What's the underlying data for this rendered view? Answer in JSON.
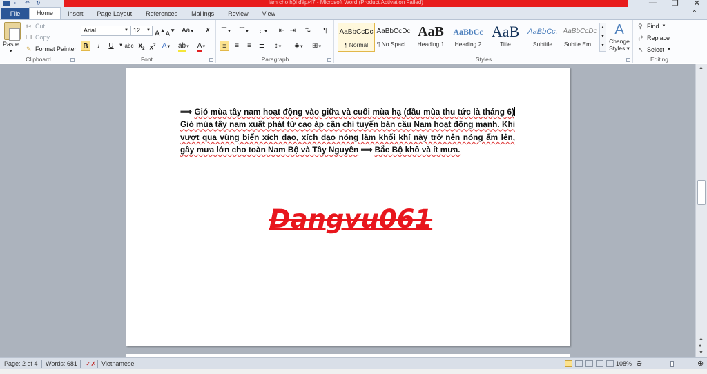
{
  "window": {
    "title": "làm cho hội đáp/47 - Microsoft Word (Product Activation Failed)",
    "min_glyph": "—",
    "max_glyph": "❐",
    "close_glyph": "✕"
  },
  "tabs": [
    {
      "label": "File"
    },
    {
      "label": "Home"
    },
    {
      "label": "Insert"
    },
    {
      "label": "Page Layout"
    },
    {
      "label": "References"
    },
    {
      "label": "Mailings"
    },
    {
      "label": "Review"
    },
    {
      "label": "View"
    }
  ],
  "clipboard": {
    "paste": "Paste",
    "cut": "Cut",
    "copy": "Copy",
    "format_painter": "Format Painter",
    "label": "Clipboard"
  },
  "font": {
    "name": "Arial",
    "size": "12",
    "label": "Font",
    "grow": "A",
    "shrink": "A",
    "case": "Aa",
    "bold": "B",
    "italic": "I",
    "underline": "U",
    "strike": "abc",
    "subscript": "x",
    "superscript": "x"
  },
  "paragraph": {
    "label": "Paragraph",
    "pilcrow": "¶"
  },
  "styles": {
    "label": "Styles",
    "items": [
      {
        "sample": "AaBbCcDc",
        "name": "¶ Normal"
      },
      {
        "sample": "AaBbCcDc",
        "name": "¶ No Spaci..."
      },
      {
        "sample": "AaB",
        "name": "Heading 1"
      },
      {
        "sample": "AaBbCc",
        "name": "Heading 2"
      },
      {
        "sample": "AaB",
        "name": "Title"
      },
      {
        "sample": "AaBbCc.",
        "name": "Subtitle"
      },
      {
        "sample": "AaBbCcDc",
        "name": "Subtle Em..."
      }
    ],
    "change_styles_1": "Change",
    "change_styles_2": "Styles"
  },
  "editing": {
    "label": "Editing",
    "find": "Find",
    "replace": "Replace",
    "select": "Select"
  },
  "document": {
    "arrow1": "⟹",
    "seg1": "Gió mùa tây nam hoạt động vào giữa và cuối mùa hạ (đầu mùa thu tức là tháng 6)",
    "seg2": "Gió mùa tây nam xuất phát từ cao áp cận chí tuyến bán cầu Nam hoạt động mạnh. Khi vượt qua vùng biển xích đạo, xích đạo nóng làm khối khí này trở nên nóng ẩm lên, gây mưa lớn cho toàn Nam Bộ và Tây Nguyên",
    "arrow2": "⟹",
    "seg3": "Bắc Bộ khô và ít mưa.",
    "watermark": "Dangvu061"
  },
  "status": {
    "page": "Page: 2 of 4",
    "words": "Words: 681",
    "language": "Vietnamese",
    "zoom": "108%",
    "zoom_level": 0.54
  }
}
